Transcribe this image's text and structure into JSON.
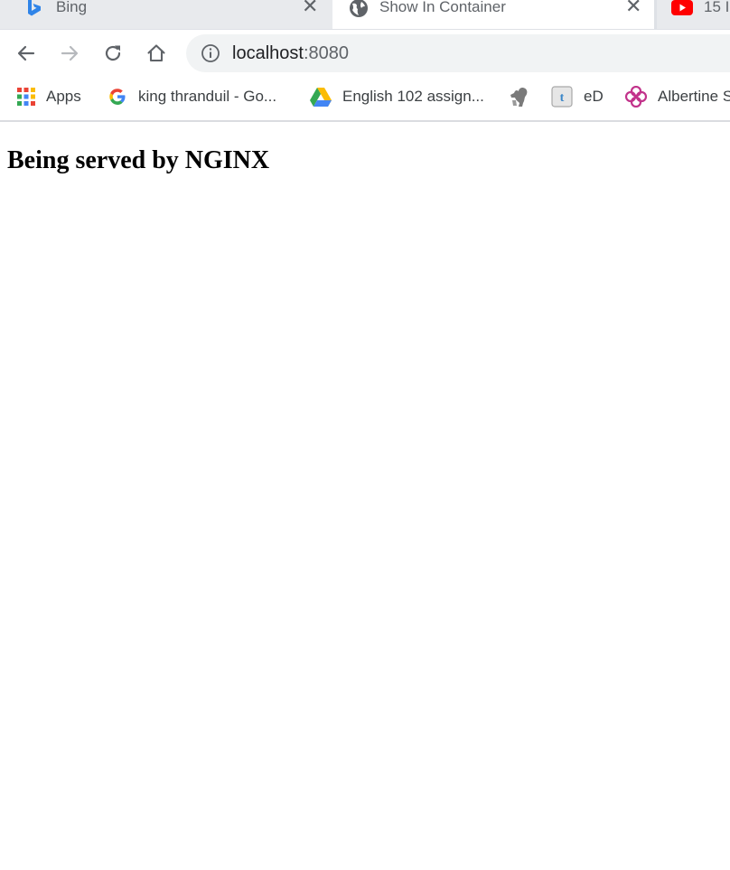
{
  "tabs": [
    {
      "title": "Bing",
      "icon": "bing-icon"
    },
    {
      "title": "Show In Container",
      "icon": "globe-icon",
      "active": true
    },
    {
      "title": "15 I",
      "icon": "youtube-icon"
    }
  ],
  "toolbar": {
    "url_host": "localhost",
    "url_port": ":8080"
  },
  "bookmarks": [
    {
      "label": "Apps",
      "icon": "apps-grid-icon"
    },
    {
      "label": "king thranduil - Go...",
      "icon": "google-icon"
    },
    {
      "label": "English 102 assign...",
      "icon": "google-drive-icon"
    },
    {
      "label": "",
      "icon": "squirrel-icon"
    },
    {
      "label": "eD",
      "icon": "t-badge-icon"
    },
    {
      "label": "Albertine S",
      "icon": "knot-icon"
    }
  ],
  "page": {
    "heading": "Being served by NGINX"
  },
  "colors": {
    "tabstrip": "#dee1e6",
    "omnibox": "#f1f3f4",
    "youtube_red": "#ff0000"
  }
}
